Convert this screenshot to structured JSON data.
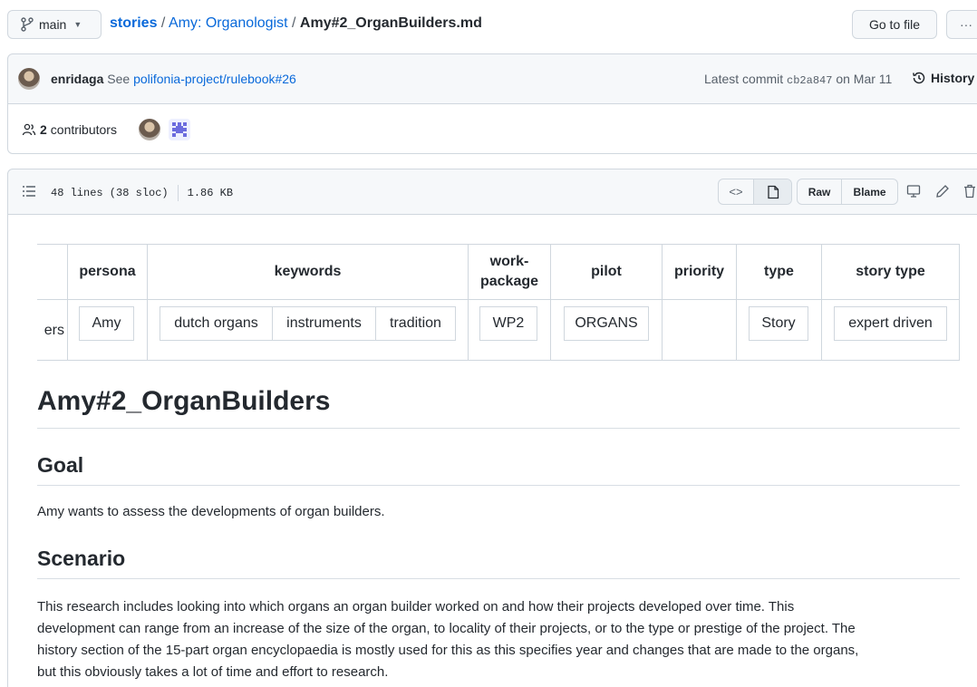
{
  "branch": {
    "label": "main"
  },
  "breadcrumb": {
    "repo": "stories",
    "folder": "Amy: Organologist",
    "sep": "/",
    "file": "Amy#2_OrganBuilders.md"
  },
  "toolbar": {
    "go_to_file": "Go to file",
    "more": "···"
  },
  "commit": {
    "author": "enridaga",
    "message_prefix": "See",
    "message_link": "polifonia-project/rulebook#26",
    "latest_label": "Latest commit",
    "hash": "cb2a847",
    "date": "on Mar 11",
    "history": "History"
  },
  "contributors": {
    "count": "2",
    "label": "contributors"
  },
  "file_info": {
    "lines": "48 lines (38 sloc)",
    "size": "1.86 KB"
  },
  "file_actions": {
    "raw": "Raw",
    "blame": "Blame"
  },
  "table": {
    "headers": {
      "persona": "persona",
      "keywords": "keywords",
      "workpackage_1": "work-",
      "workpackage_2": "package",
      "pilot": "pilot",
      "priority": "priority",
      "type": "type",
      "story_type": "story type"
    },
    "row": {
      "partial": "ers",
      "persona": "Amy",
      "kw1": "dutch organs",
      "kw2": "instruments",
      "kw3": "tradition",
      "workpackage": "WP2",
      "pilot": "ORGANS",
      "type": "Story",
      "story_type": "expert driven"
    }
  },
  "doc": {
    "title": "Amy#2_OrganBuilders",
    "goal_heading": "Goal",
    "goal_text": "Amy wants to assess the developments of organ builders.",
    "scenario_heading": "Scenario",
    "scenario_lines": [
      "This research includes looking into which organs an organ builder worked on and how their projects developed over time. This",
      "development can range from an increase of the size of the organ, to locality of their projects, or to the type or prestige of the project. The",
      "history section of the 15-part organ encyclopaedia is mostly used for this as this specifies year and changes that are made to the organs,",
      "but this obviously takes a lot of time and effort to research."
    ]
  }
}
